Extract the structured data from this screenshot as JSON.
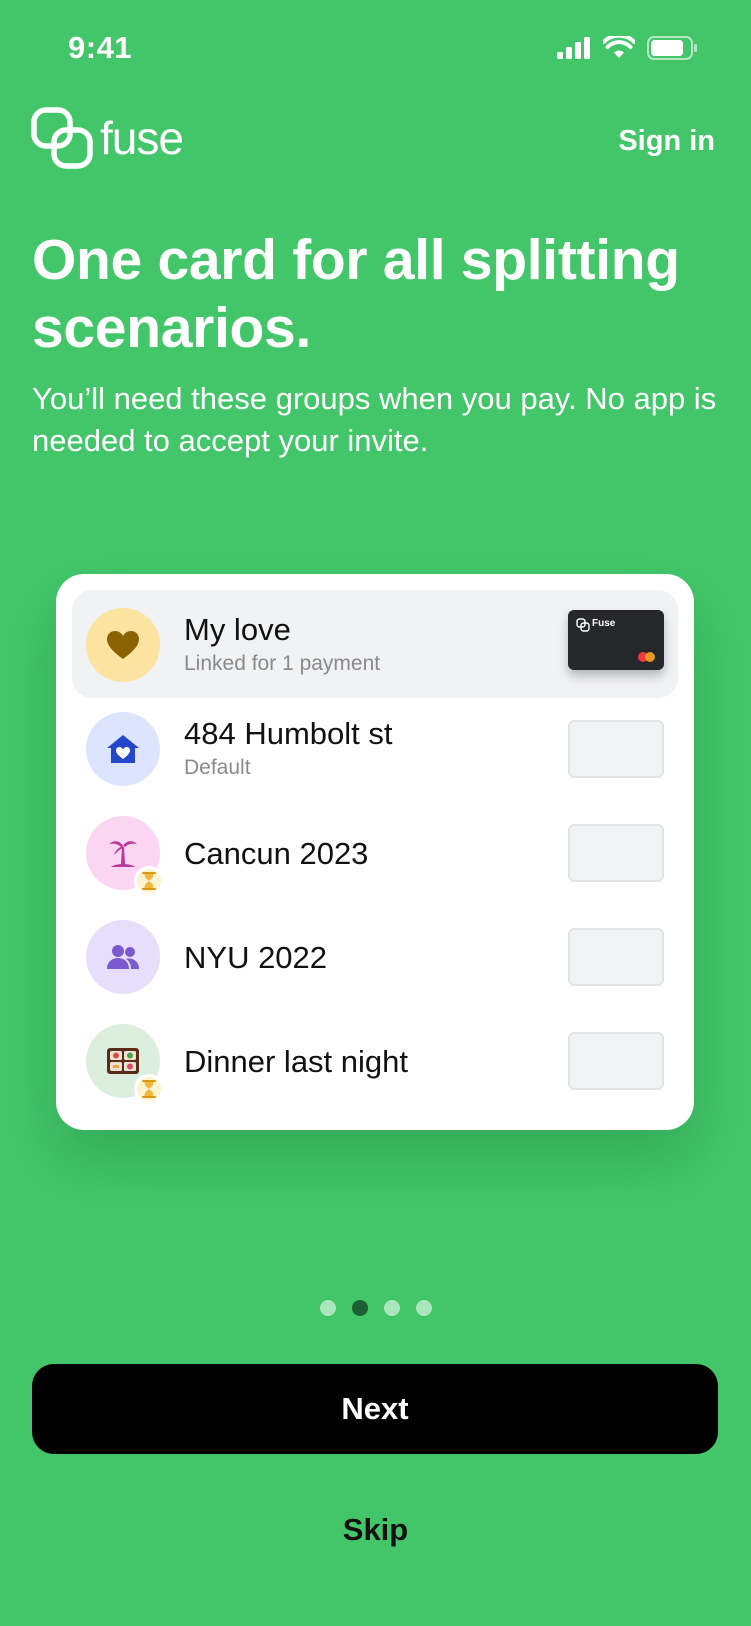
{
  "status": {
    "time": "9:41"
  },
  "header": {
    "logo_text": "fuse",
    "signin_label": "Sign in"
  },
  "onboarding": {
    "headline": "One card for all splitting scenarios.",
    "subtext": "You’ll need these groups when you pay. No app is needed to accept your invite."
  },
  "groups": [
    {
      "title": "My love",
      "subtitle": "Linked for 1 payment",
      "icon": "heart-icon",
      "avatar_color": "#fde3a0",
      "linked": true,
      "pending": false
    },
    {
      "title": "484 Humbolt st",
      "subtitle": "Default",
      "icon": "house-heart-icon",
      "avatar_color": "#dde4fd",
      "linked": false,
      "pending": false
    },
    {
      "title": "Cancun 2023",
      "subtitle": "",
      "icon": "palm-tree-icon",
      "avatar_color": "#fbd5f1",
      "linked": false,
      "pending": true
    },
    {
      "title": "NYU 2022",
      "subtitle": "",
      "icon": "people-icon",
      "avatar_color": "#e6defb",
      "linked": false,
      "pending": false
    },
    {
      "title": "Dinner last night",
      "subtitle": "",
      "icon": "bento-box-icon",
      "avatar_color": "#dcefdf",
      "linked": false,
      "pending": true
    }
  ],
  "mini_card": {
    "label": "Fuse"
  },
  "pagination": {
    "total": 4,
    "current": 2
  },
  "actions": {
    "next_label": "Next",
    "skip_label": "Skip"
  },
  "colors": {
    "background": "#43c66a",
    "button": "#000000",
    "active_dot": "#1f5f35"
  }
}
